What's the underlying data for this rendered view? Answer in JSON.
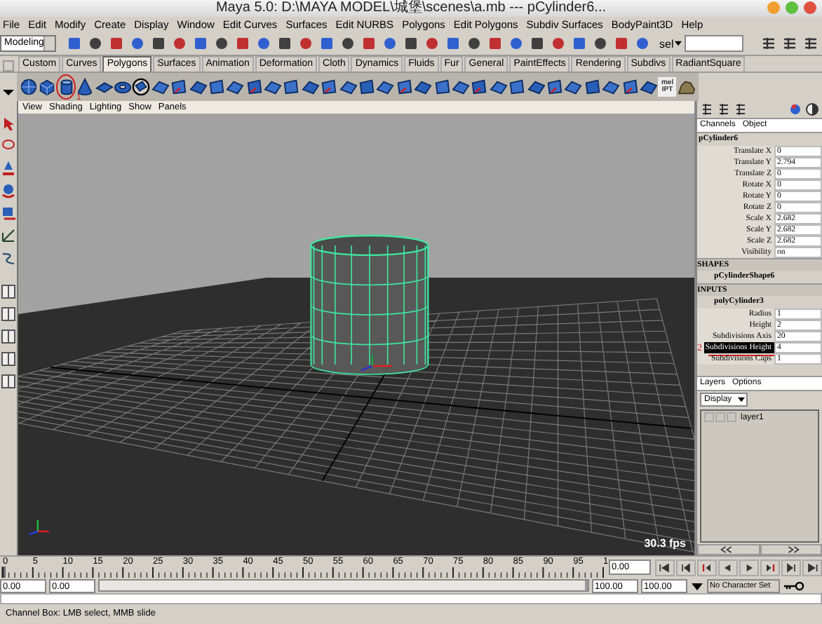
{
  "window": {
    "title": "Maya 5.0: D:\\MAYA MODEL\\城堡\\scenes\\a.mb  ---  pCylinder6..."
  },
  "menu": [
    "File",
    "Edit",
    "Modify",
    "Create",
    "Display",
    "Window",
    "Edit Curves",
    "Surfaces",
    "Edit NURBS",
    "Polygons",
    "Edit Polygons",
    "Subdiv Surfaces",
    "BodyPaint3D",
    "Help"
  ],
  "status_line": {
    "mode": "Modeling",
    "selection_label": "sel"
  },
  "shelf_tabs": [
    {
      "label": "Custom",
      "selected": false
    },
    {
      "label": "Curves",
      "selected": false
    },
    {
      "label": "Polygons",
      "selected": true
    },
    {
      "label": "Surfaces",
      "selected": false
    },
    {
      "label": "Animation",
      "selected": false
    },
    {
      "label": "Deformation",
      "selected": false
    },
    {
      "label": "Cloth",
      "selected": false
    },
    {
      "label": "Dynamics",
      "selected": false
    },
    {
      "label": "Fluids",
      "selected": false
    },
    {
      "label": "Fur",
      "selected": false
    },
    {
      "label": "General",
      "selected": false
    },
    {
      "label": "PaintEffects",
      "selected": false
    },
    {
      "label": "Rendering",
      "selected": false
    },
    {
      "label": "Subdivs",
      "selected": false
    },
    {
      "label": "RadiantSquare",
      "selected": false
    }
  ],
  "shelf": {
    "mel_icon_top": "mel",
    "mel_icon_bottom": "IPT"
  },
  "annotations": [
    {
      "label": "1"
    },
    {
      "label": "2"
    }
  ],
  "viewport": {
    "menu": [
      "View",
      "Shading",
      "Lighting",
      "Show",
      "Panels"
    ],
    "fps": "30.3 fps"
  },
  "channel_box": {
    "tabs": [
      "Channels",
      "Object"
    ],
    "node": "pCylinder6",
    "attributes": [
      {
        "name": "Translate X",
        "value": "0"
      },
      {
        "name": "Translate Y",
        "value": "2.794"
      },
      {
        "name": "Translate Z",
        "value": "0"
      },
      {
        "name": "Rotate X",
        "value": "0"
      },
      {
        "name": "Rotate Y",
        "value": "0"
      },
      {
        "name": "Rotate Z",
        "value": "0"
      },
      {
        "name": "Scale X",
        "value": "2.682"
      },
      {
        "name": "Scale Y",
        "value": "2.682"
      },
      {
        "name": "Scale Z",
        "value": "2.682"
      },
      {
        "name": "Visibility",
        "value": "on"
      }
    ],
    "shapes_header": "SHAPES",
    "shape": "pCylinderShape6",
    "inputs_header": "INPUTS",
    "input": "polyCylinder3",
    "input_attributes": [
      {
        "name": "Radius",
        "value": "1",
        "selected": false
      },
      {
        "name": "Height",
        "value": "2",
        "selected": false
      },
      {
        "name": "Subdivisions Axis",
        "value": "20",
        "selected": false
      },
      {
        "name": "Subdivisions Height",
        "value": "4",
        "selected": true
      },
      {
        "name": "Subdivisions Caps",
        "value": "1",
        "selected": false
      }
    ]
  },
  "layers": {
    "tabs": [
      "Layers",
      "Options"
    ],
    "display": "Display",
    "items": [
      {
        "name": "layer1"
      }
    ]
  },
  "time_slider": {
    "ticks": [
      "0",
      "5",
      "10",
      "15",
      "20",
      "25",
      "30",
      "35",
      "40",
      "45",
      "50",
      "55",
      "60",
      "65",
      "70",
      "75",
      "80",
      "85",
      "90",
      "95",
      "1"
    ],
    "current_time": "0.00",
    "level": 0
  },
  "range_slider": {
    "start": "0.00",
    "playback_start": "0.00",
    "playback_end": "100.00",
    "end": "100.00",
    "character_set": "No Character Set",
    "level": 1
  },
  "help_line": "Channel Box: LMB select, MMB slide"
}
